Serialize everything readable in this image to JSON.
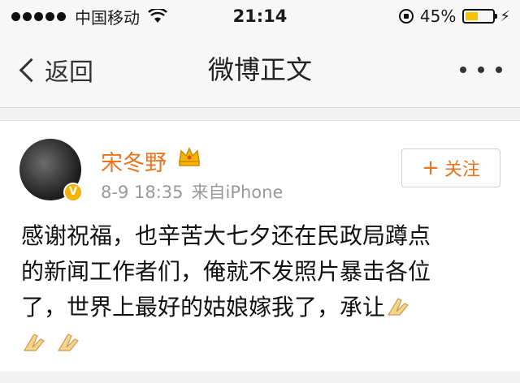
{
  "status_bar": {
    "carrier": "中国移动",
    "time": "21:14",
    "battery_percent": "45%",
    "battery_level": 0.45,
    "battery_color": "#f6c300"
  },
  "nav": {
    "back_label": "返回",
    "title": "微博正文",
    "more_icon": "ellipsis-icon"
  },
  "post": {
    "author": "宋冬野",
    "author_color": "#e8741e",
    "badge_icon": "crown-icon",
    "verified_icon": "verified-v-icon",
    "timestamp": "8-9 18:35",
    "source": "来自iPhone",
    "follow_label": "关注",
    "text_line_1": "感谢祝福，也辛苦大七夕还在民政局蹲点",
    "text_line_2": "的新闻工作者们，俺就不发照片暴击各位",
    "text_line_3": "了，世界上最好的姑娘嫁我了，承让",
    "emoji_name": "praying-hands-emoji"
  }
}
